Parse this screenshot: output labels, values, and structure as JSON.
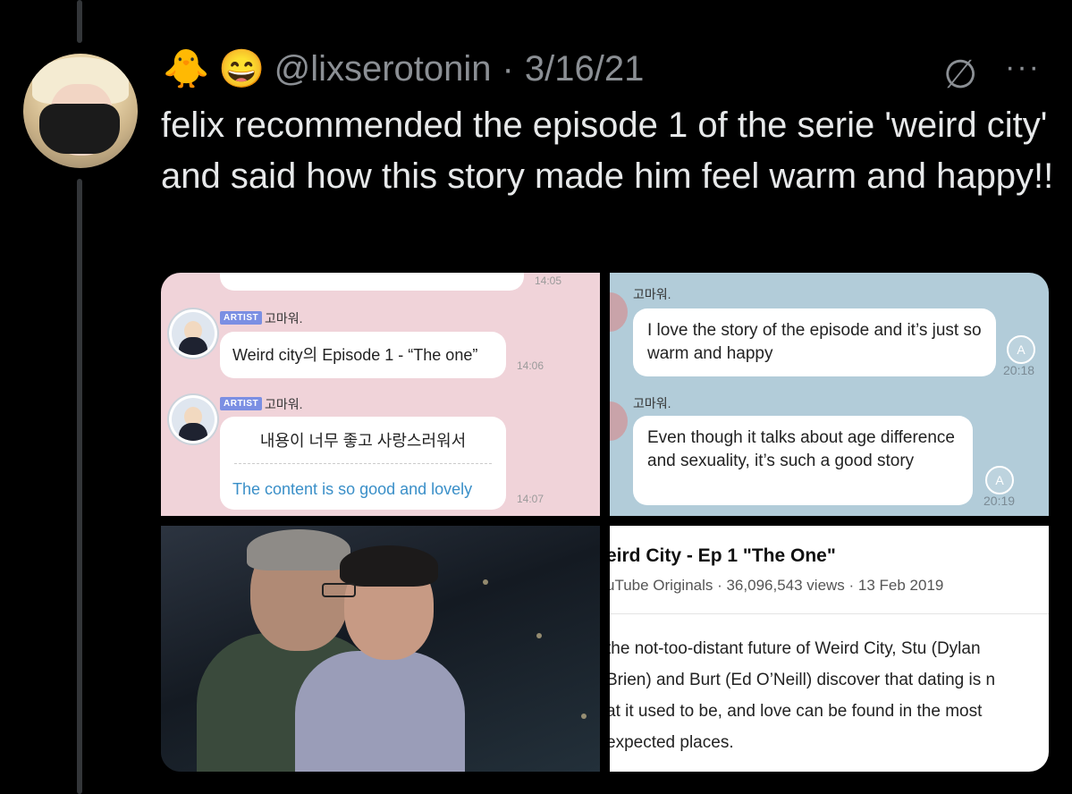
{
  "tweet": {
    "emoji_1": "🐥",
    "emoji_2": "😄",
    "handle": "@lixserotonin",
    "separator": "·",
    "date": "3/16/21",
    "text": "felix recommended the episode 1 of the serie 'weird city' and said how this story made him feel warm and happy!!",
    "icons": [
      "empty-set-icon",
      "more-icon"
    ]
  },
  "chat_pink": {
    "top_time": "14:05",
    "artist_badge": "ARTIST",
    "sender_name": "고마워.",
    "msg1": "Weird city의 Episode 1 - “The one”",
    "msg1_time": "14:06",
    "msg2_korean": "내용이 너무 좋고 사랑스러워서",
    "msg2_translation": "The content is so good and lovely",
    "msg2_time": "14:07"
  },
  "chat_blue": {
    "sender_name": "고마워.",
    "msg1": "I love the story of the episode and it’s just so warm and happy",
    "msg1_time": "20:18",
    "msg2": "Even though it talks about age difference and sexuality, it’s such a good story",
    "msg2_time": "20:19",
    "replay_glyph": "A"
  },
  "youtube": {
    "title": "eird City - Ep 1 \"The One\"",
    "meta": "uTube Originals · 36,096,543 views · 13 Feb 2019",
    "desc_lines": [
      "the not-too-distant future of Weird City, Stu (Dylan",
      "Brien) and Burt (Ed O’Neill) discover that dating is n",
      "at it used to be, and love can be found in the most",
      "expected places."
    ]
  }
}
